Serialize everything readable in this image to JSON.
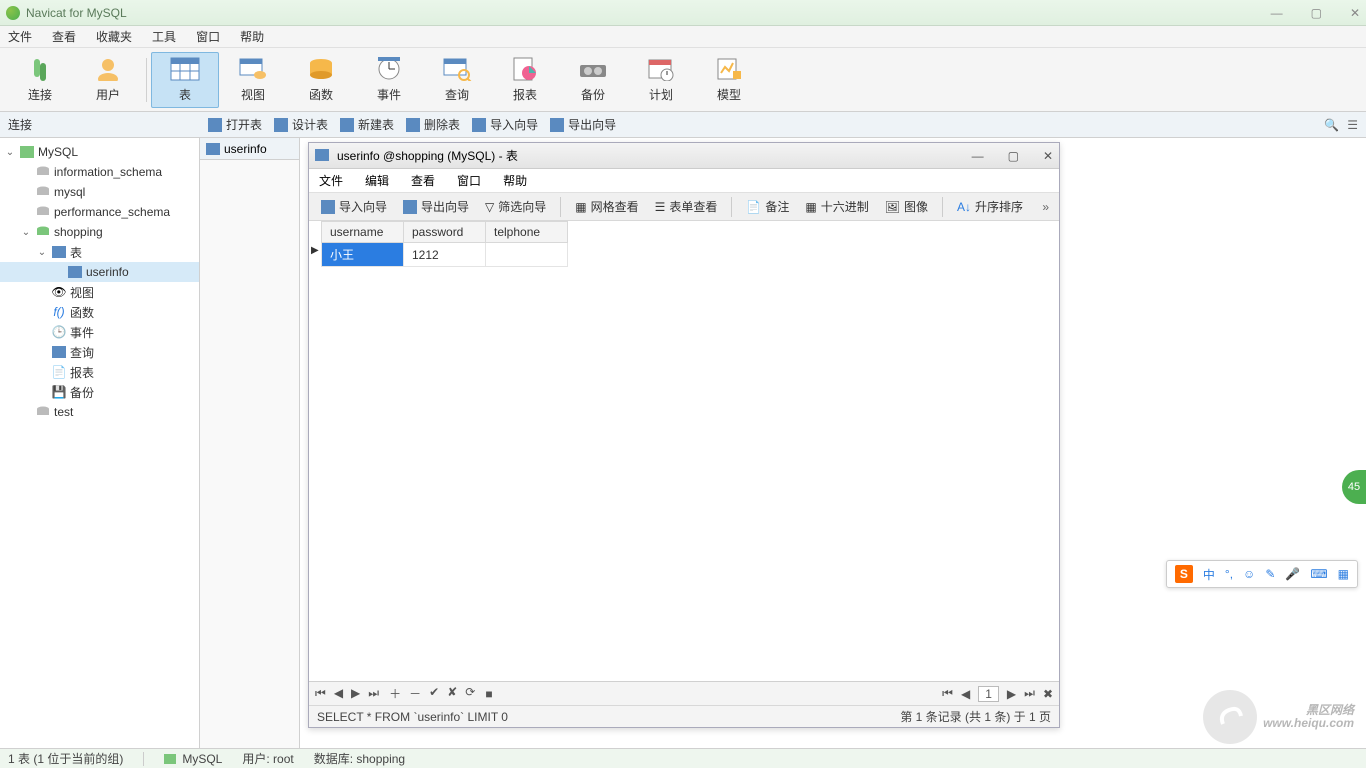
{
  "app": {
    "title": "Navicat for MySQL"
  },
  "menu": {
    "file": "文件",
    "view": "查看",
    "favorites": "收藏夹",
    "tools": "工具",
    "window": "窗口",
    "help": "帮助"
  },
  "toolbar": {
    "connect": "连接",
    "user": "用户",
    "table": "表",
    "view": "视图",
    "function": "函数",
    "event": "事件",
    "query": "查询",
    "report": "报表",
    "backup": "备份",
    "schedule": "计划",
    "model": "模型"
  },
  "subtoolbar": {
    "conn": "连接",
    "open": "打开表",
    "design": "设计表",
    "new": "新建表",
    "delete": "删除表",
    "import": "导入向导",
    "export": "导出向导"
  },
  "tree": {
    "mysql": "MySQL",
    "information_schema": "information_schema",
    "mysql_db": "mysql",
    "performance_schema": "performance_schema",
    "shopping": "shopping",
    "tables": "表",
    "userinfo": "userinfo",
    "views": "视图",
    "functions": "函数",
    "events": "事件",
    "queries": "查询",
    "reports": "报表",
    "backups": "备份",
    "test": "test"
  },
  "tab": {
    "userinfo": "userinfo"
  },
  "innerWindow": {
    "title": "userinfo @shopping (MySQL) - 表",
    "menu": {
      "file": "文件",
      "edit": "编辑",
      "view": "查看",
      "window": "窗口",
      "help": "帮助"
    },
    "tools": {
      "import": "导入向导",
      "export": "导出向导",
      "filter": "筛选向导",
      "gridview": "网格查看",
      "formview": "表单查看",
      "note": "备注",
      "hex": "十六进制",
      "image": "图像",
      "sort": "升序排序"
    },
    "columns": [
      "username",
      "password",
      "telphone"
    ],
    "rows": [
      {
        "username": "小王",
        "password": "1212",
        "telphone": ""
      }
    ],
    "sql": "SELECT * FROM `userinfo` LIMIT 0",
    "recordInfo": "第 1 条记录 (共 1 条) 于 1 页",
    "page": "1"
  },
  "status": {
    "left": "1 表 (1 位于当前的组)",
    "conn": "MySQL",
    "user": "用户: root",
    "db": "数据库: shopping"
  },
  "ime": {
    "lang": "中"
  },
  "badge": "45",
  "watermark": {
    "line1": "黑区网络",
    "line2": "www.heiqu.com"
  }
}
